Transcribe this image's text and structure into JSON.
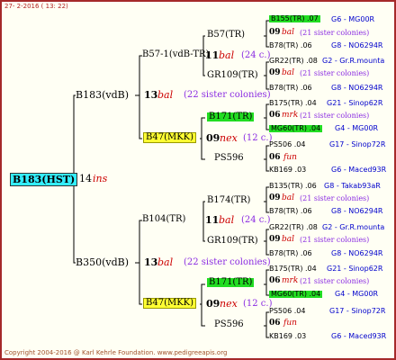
{
  "timestamp": "27- 2-2016 ( 13: 22)",
  "footer": "Copyright 2004-2016 @ Karl Kehrle Foundation.   www.pedigreeapis.org",
  "root": {
    "name": "B183(HST)",
    "gen": "14",
    "label": "ins"
  },
  "upper": {
    "name": "B183(vdB)",
    "gen": "13",
    "label": "bal",
    "sis": "(22 sister colonies)",
    "a": {
      "name": "B57-1(vdB-TR)",
      "gen": "11",
      "label": "bal",
      "sis": "(24 c.)",
      "a": {
        "name": "B57(TR)",
        "gen": "09",
        "label": "bal",
        "sis": "(21 sister colonies)",
        "a": {
          "name": "B155(TR) .07",
          "src": "G6 - MG00R"
        },
        "b": {
          "name": "B78(TR) .06",
          "src": "G8 - NO6294R"
        }
      },
      "b": {
        "name": "GR109(TR)",
        "gen": "09",
        "label": "bal",
        "sis": "(21 sister colonies)",
        "a": {
          "name": "GR22(TR) .08",
          "src": "G2 - Gr.R.mounta"
        },
        "b": {
          "name": "B78(TR) .06",
          "src": "G8 - NO6294R"
        }
      }
    },
    "b": {
      "name": "B47(MKK)",
      "gen": "09",
      "label": "nex",
      "sis": "(12 c.)",
      "a": {
        "name": "B171(TR)",
        "gen": "06",
        "label": "mrk",
        "sis": "(21 sister colonies)",
        "a": {
          "name": "B175(TR) .04",
          "src": "G21 - Sinop62R"
        },
        "b": {
          "name": "MG60(TR) .04",
          "src": "G4 - MG00R"
        }
      },
      "b": {
        "name": "PS596",
        "gen": "06",
        "label": "fun",
        "a": {
          "name": "PS506 .04",
          "src": "G17 - Sinop72R"
        },
        "b": {
          "name": "KB169 .03",
          "src": "G6 - Maced93R"
        }
      }
    }
  },
  "lower": {
    "name": "B350(vdB)",
    "gen": "13",
    "label": "bal",
    "sis": "(22 sister colonies)",
    "a": {
      "name": "B104(TR)",
      "gen": "11",
      "label": "bal",
      "sis": "(24 c.)",
      "a": {
        "name": "B174(TR)",
        "gen": "09",
        "label": "bal",
        "sis": "(21 sister colonies)",
        "a": {
          "name": "B135(TR) .06",
          "src": "G8 - Takab93aR"
        },
        "b": {
          "name": "B78(TR) .06",
          "src": "G8 - NO6294R"
        }
      },
      "b": {
        "name": "GR109(TR)",
        "gen": "09",
        "label": "bal",
        "sis": "(21 sister colonies)",
        "a": {
          "name": "GR22(TR) .08",
          "src": "G2 - Gr.R.mounta"
        },
        "b": {
          "name": "B78(TR) .06",
          "src": "G8 - NO6294R"
        }
      }
    },
    "b": {
      "name": "B47(MKK)",
      "gen": "09",
      "label": "nex",
      "sis": "(12 c.)",
      "a": {
        "name": "B171(TR)",
        "gen": "06",
        "label": "mrk",
        "sis": "(21 sister colonies)",
        "a": {
          "name": "B175(TR) .04",
          "src": "G21 - Sinop62R"
        },
        "b": {
          "name": "MG60(TR) .04",
          "src": "G4 - MG00R"
        }
      },
      "b": {
        "name": "PS596",
        "gen": "06",
        "label": "fun",
        "a": {
          "name": "PS506 .04",
          "src": "G17 - Sinop72R"
        },
        "b": {
          "name": "KB169 .03",
          "src": "G6 - Maced93R"
        }
      }
    }
  },
  "colors": {
    "border": "#a52a2a",
    "root_bg": "#33eeff",
    "green_bg": "#22dd22",
    "yellow_bg": "#ffff33",
    "label": "#cc0000",
    "sister": "#8a2be2",
    "source": "#0000cc"
  }
}
